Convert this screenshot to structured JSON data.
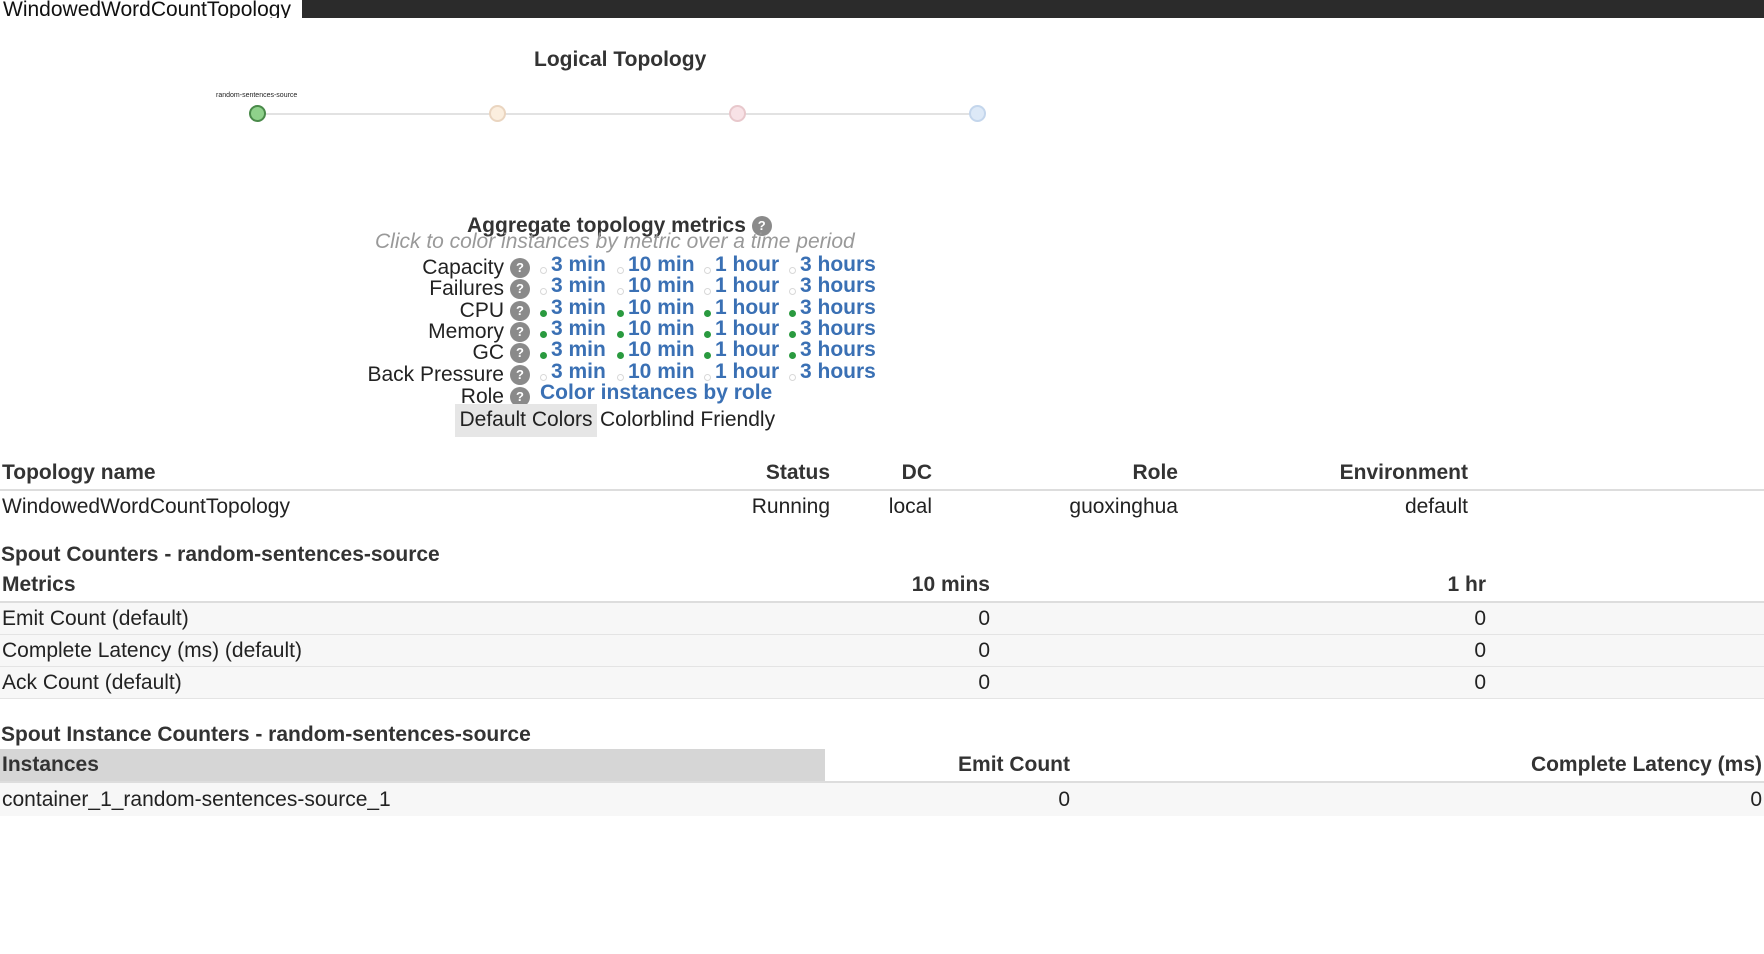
{
  "window": {
    "title": "WindowedWordCountTopology"
  },
  "logical_topology": {
    "title": "Logical Topology",
    "nodes": [
      {
        "label": "random-sentences-source",
        "color": "#8fd18b",
        "border": "#4a8a4a"
      },
      {
        "label": "",
        "color": "#fbeede",
        "border": "#ead5c0"
      },
      {
        "label": "",
        "color": "#f8e2e6",
        "border": "#e8c8cc"
      },
      {
        "label": "",
        "color": "#dde9f7",
        "border": "#c4d6ec"
      }
    ]
  },
  "aggregate": {
    "title": "Aggregate topology metrics",
    "subtitle": "Click to color instances by metric over a time period",
    "help_glyph": "?",
    "periods": [
      "3 min",
      "10 min",
      "1 hour",
      "3 hours"
    ],
    "metrics": [
      {
        "label": "Capacity",
        "dots": [
          false,
          false,
          false,
          false
        ]
      },
      {
        "label": "Failures",
        "dots": [
          false,
          false,
          false,
          false
        ]
      },
      {
        "label": "CPU",
        "dots": [
          true,
          true,
          true,
          true
        ]
      },
      {
        "label": "Memory",
        "dots": [
          true,
          true,
          true,
          true
        ]
      },
      {
        "label": "GC",
        "dots": [
          true,
          true,
          true,
          true
        ]
      },
      {
        "label": "Back Pressure",
        "dots": [
          false,
          false,
          false,
          false
        ]
      }
    ],
    "role_label": "Role",
    "role_link": "Color instances by role",
    "buttons": {
      "default": "Default Colors",
      "colorblind": "Colorblind Friendly"
    }
  },
  "topology_table": {
    "headers": [
      "Topology name",
      "Status",
      "DC",
      "Role",
      "Environment"
    ],
    "row": [
      "WindowedWordCountTopology",
      "Running",
      "local",
      "guoxinghua",
      "default"
    ]
  },
  "spout_counters": {
    "title": "Spout Counters - random-sentences-source",
    "headers": [
      "Metrics",
      "10 mins",
      "1 hr"
    ],
    "rows": [
      [
        "Emit Count (default)",
        "0",
        "0"
      ],
      [
        "Complete Latency (ms) (default)",
        "0",
        "0"
      ],
      [
        "Ack Count (default)",
        "0",
        "0"
      ]
    ]
  },
  "instance_counters": {
    "title": "Spout Instance Counters - random-sentences-source",
    "headers": [
      "Instances",
      "Emit Count",
      "Complete Latency (ms)"
    ],
    "rows": [
      [
        "container_1_random-sentences-source_1",
        "0",
        "0"
      ]
    ]
  }
}
